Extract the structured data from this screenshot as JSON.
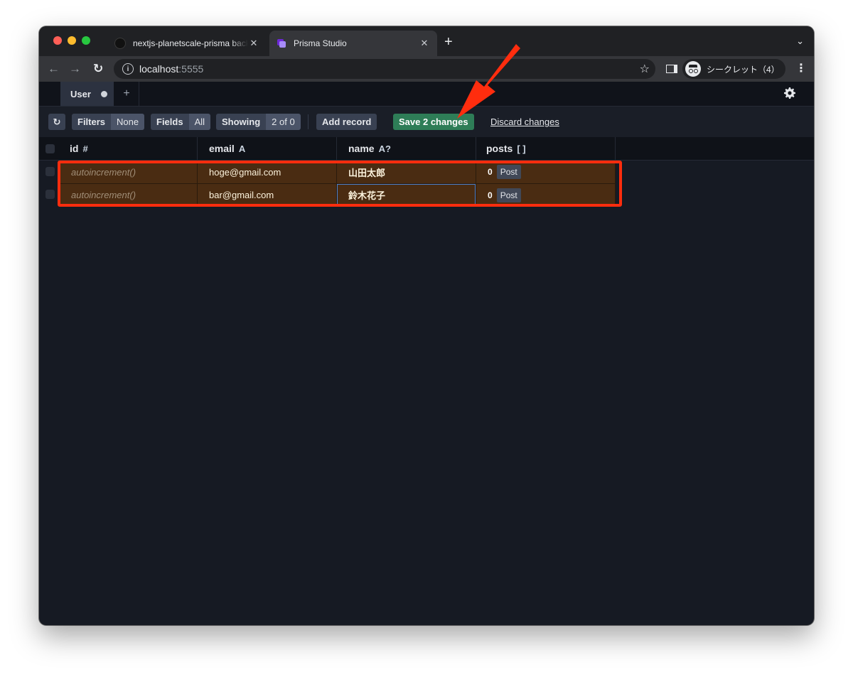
{
  "browser": {
    "tabs": [
      {
        "title": "nextjs-planetscale-prisma backend",
        "close": "✕"
      },
      {
        "title": "Prisma Studio",
        "close": "✕"
      }
    ],
    "new_tab": "+",
    "tab_menu": "⌄",
    "url_host": "localhost",
    "url_port": ":5555",
    "profile_label": "シークレット（4）"
  },
  "app": {
    "model_tab": "User",
    "add_tab": "+",
    "toolbar": {
      "refresh": "↻",
      "filters_label": "Filters",
      "filters_value": "None",
      "fields_label": "Fields",
      "fields_value": "All",
      "showing_label": "Showing",
      "showing_value": "2 of 0",
      "add_record": "Add record",
      "save_changes": "Save 2 changes",
      "discard_changes": "Discard changes"
    },
    "columns": [
      {
        "name": "id",
        "type": "#"
      },
      {
        "name": "email",
        "type": "A"
      },
      {
        "name": "name",
        "type": "A?"
      },
      {
        "name": "posts",
        "type": "[ ]"
      }
    ],
    "rows": [
      {
        "id": "autoincrement()",
        "email": "hoge@gmail.com",
        "name": "山田太郎",
        "posts_count": "0",
        "posts_label": "Post"
      },
      {
        "id": "autoincrement()",
        "email": "bar@gmail.com",
        "name": "鈴木花子",
        "posts_count": "0",
        "posts_label": "Post"
      }
    ]
  },
  "colors": {
    "annotation": "#ff2d0e",
    "save_button": "#2e7d57",
    "pending_row": "#4a2c12"
  }
}
